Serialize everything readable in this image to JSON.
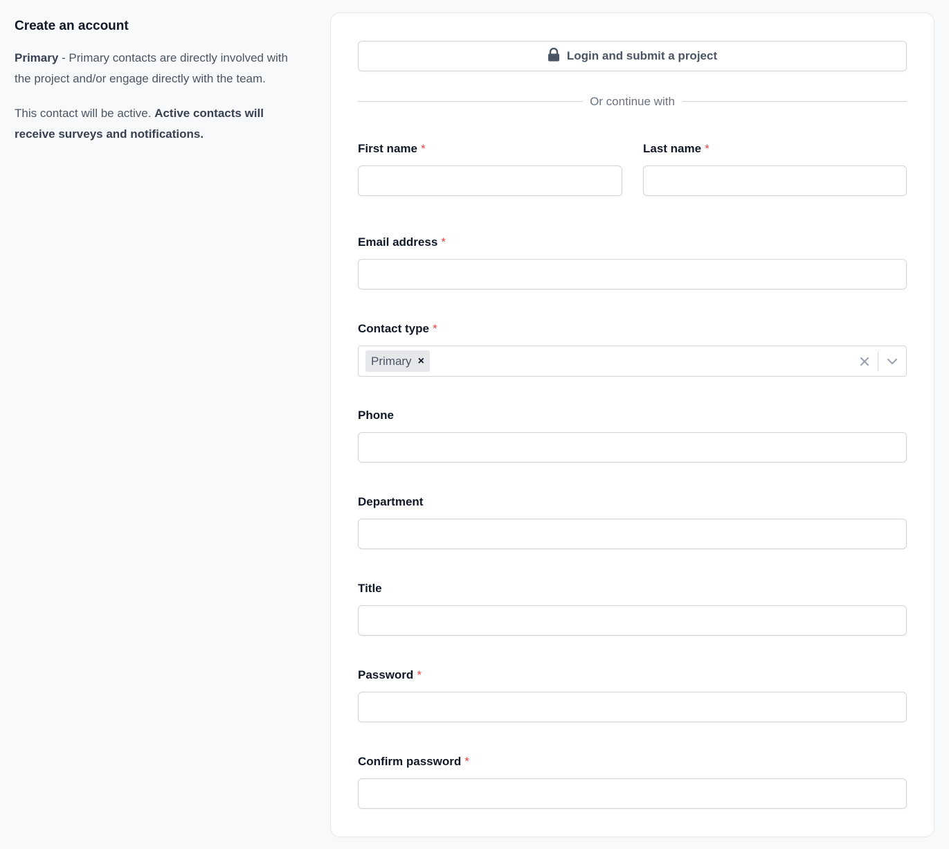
{
  "aside": {
    "title": "Create an account",
    "p1_strong": "Primary",
    "p1_text": " - Primary contacts are directly involved with the project and/or engage directly with the team.",
    "p2_text": "This contact will be active. ",
    "p2_strong": "Active contacts will receive surveys and notifications."
  },
  "login_button": {
    "label": "Login and submit a project",
    "icon": "lock-icon"
  },
  "divider_text": "Or continue with",
  "required_mark": "*",
  "fields": {
    "first_name": {
      "label": "First name",
      "value": ""
    },
    "last_name": {
      "label": "Last name",
      "value": ""
    },
    "email": {
      "label": "Email address",
      "value": ""
    },
    "contact_type": {
      "label": "Contact type",
      "selected": [
        "Primary"
      ],
      "remove_glyph": "×"
    },
    "phone": {
      "label": "Phone",
      "value": ""
    },
    "department": {
      "label": "Department",
      "value": ""
    },
    "title": {
      "label": "Title",
      "value": ""
    },
    "password": {
      "label": "Password",
      "value": ""
    },
    "confirm_password": {
      "label": "Confirm password",
      "value": ""
    }
  },
  "colors": {
    "background": "#f8f9fa",
    "required": "#ef4444",
    "border": "#d1d5db"
  }
}
